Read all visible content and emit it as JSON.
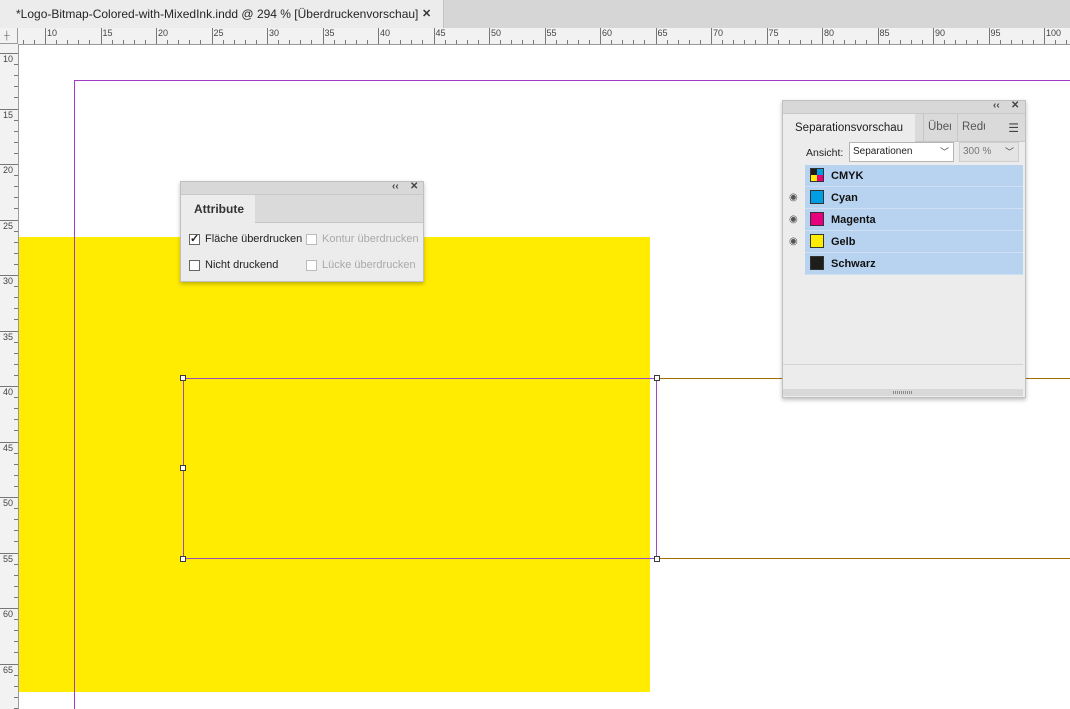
{
  "document": {
    "tab_title": "*Logo-Bitmap-Colored-with-MixedInk.indd @ 294 % [Überdruckenvorschau]",
    "close_glyph": "✕"
  },
  "rulers": {
    "horizontal_labels": [
      "10",
      "15",
      "20",
      "25",
      "30",
      "35",
      "40",
      "45",
      "50",
      "55",
      "60",
      "65",
      "70",
      "75",
      "80",
      "85",
      "90",
      "95",
      "100"
    ],
    "vertical_labels": [
      "10",
      "15",
      "20",
      "25",
      "30",
      "35",
      "40",
      "45",
      "50",
      "55",
      "60",
      "65"
    ]
  },
  "attribute_panel": {
    "tab": "Attribute",
    "options": [
      {
        "label": "Fläche überdrucken",
        "checked": true,
        "enabled": true
      },
      {
        "label": "Kontur überdrucken",
        "checked": false,
        "enabled": false
      },
      {
        "label": "Nicht druckend",
        "checked": false,
        "enabled": true
      },
      {
        "label": "Lücke überdrucken",
        "checked": false,
        "enabled": false
      }
    ]
  },
  "separations_panel": {
    "tabs": [
      "Separationsvorschau",
      "Über",
      "Redu"
    ],
    "view_label": "Ansicht:",
    "view_value": "Separationen",
    "zoom_value": "300 %",
    "inks": [
      {
        "name": "CMYK",
        "visible": false,
        "color": "cmyk"
      },
      {
        "name": "Cyan",
        "visible": true,
        "color": "#009fe3"
      },
      {
        "name": "Magenta",
        "visible": true,
        "color": "#e6007e"
      },
      {
        "name": "Gelb",
        "visible": true,
        "color": "#ffed00"
      },
      {
        "name": "Schwarz",
        "visible": false,
        "color": "#1d1d1b"
      }
    ]
  },
  "colors": {
    "yellow_fill": "#ffec00",
    "page_border": "#a13bc4",
    "guide": "#a07000",
    "selection_row": "#b8d3f0"
  }
}
